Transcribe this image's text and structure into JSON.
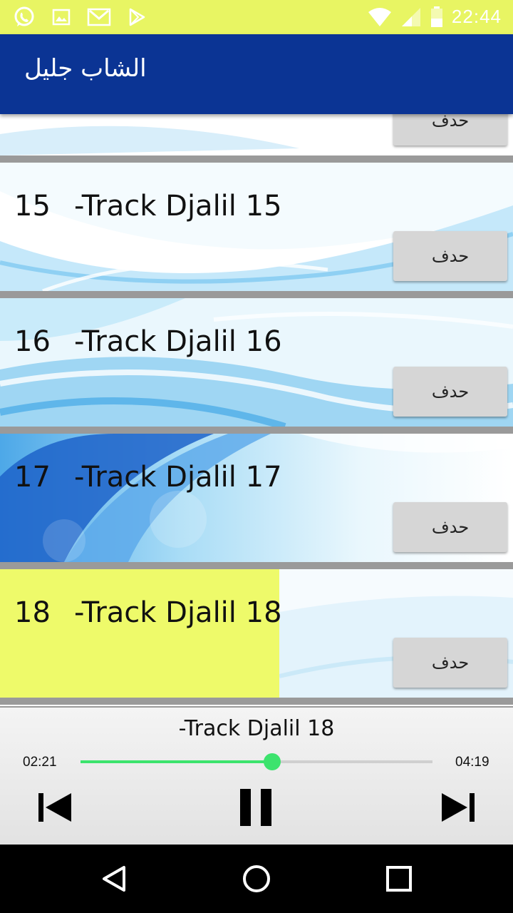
{
  "status_bar": {
    "time": "22:44",
    "left_icons": [
      "whatsapp-icon",
      "image-icon",
      "gmail-icon",
      "play-store-icon"
    ],
    "right_icons": [
      "wifi-icon",
      "signal-icon",
      "battery-icon"
    ]
  },
  "app_bar": {
    "title": "الشاب جليل"
  },
  "list": {
    "items": [
      {
        "number": "",
        "title": "",
        "delete_label": "حدف",
        "selected": false
      },
      {
        "number": "15",
        "title": "-Track Djalil 15",
        "delete_label": "حدف",
        "selected": false
      },
      {
        "number": "16",
        "title": "-Track Djalil 16",
        "delete_label": "حدف",
        "selected": false
      },
      {
        "number": "17",
        "title": "-Track Djalil 17",
        "delete_label": "حدف",
        "selected": false
      },
      {
        "number": "18",
        "title": "-Track Djalil 18",
        "delete_label": "حدف",
        "selected": true
      }
    ]
  },
  "player": {
    "title": "-Track Djalil 18",
    "elapsed": "02:21",
    "duration": "04:19",
    "progress": 0.544,
    "controls": [
      "skip-previous-icon",
      "pause-icon",
      "skip-next-icon"
    ]
  },
  "nav_bar": {
    "buttons": [
      "back-icon",
      "home-icon",
      "recents-icon"
    ]
  },
  "colors": {
    "status_bar": "#e8f563",
    "app_bar": "#0b3494",
    "highlight": "#eefa6a",
    "seek": "#3ce36d"
  }
}
